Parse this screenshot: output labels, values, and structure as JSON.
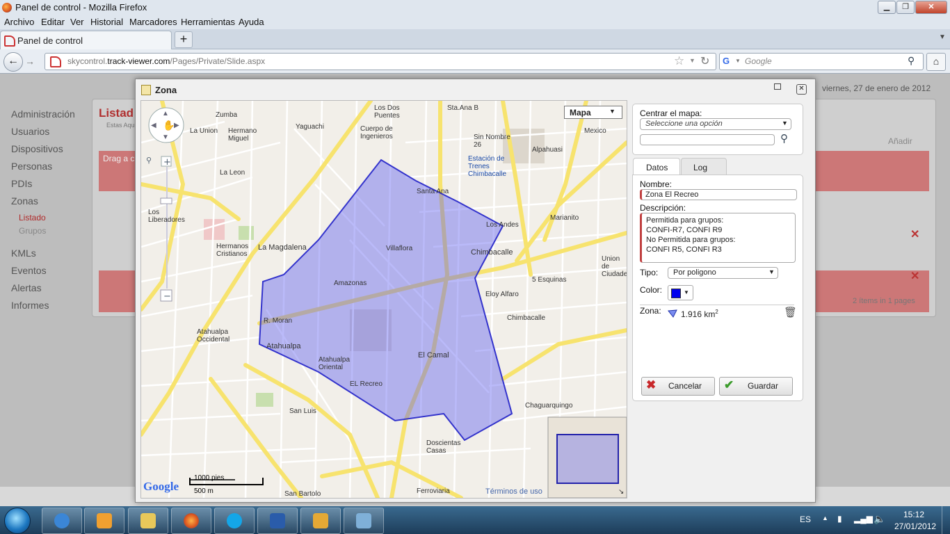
{
  "window": {
    "title": "Panel de control - Mozilla Firefox"
  },
  "menu": [
    "Archivo",
    "Editar",
    "Ver",
    "Historial",
    "Marcadores",
    "Herramientas",
    "Ayuda"
  ],
  "tab": {
    "label": "Panel de control",
    "new_tab": "+"
  },
  "nav": {
    "url_prefix": "skycontrol.",
    "url_domain": "track-viewer.com",
    "url_path": "/Pages/Private/Slide.aspx",
    "search_placeholder": "Google"
  },
  "page": {
    "date": "viernes, 27 de enero de 2012",
    "sidebar": [
      {
        "label": "Administración"
      },
      {
        "label": "Usuarios"
      },
      {
        "label": "Dispositivos"
      },
      {
        "label": "Personas"
      },
      {
        "label": "PDIs"
      },
      {
        "label": "Zonas"
      },
      {
        "label": "Listado"
      },
      {
        "label": "Grupos"
      },
      {
        "label": "KMLs"
      },
      {
        "label": "Eventos"
      },
      {
        "label": "Alertas"
      },
      {
        "label": "Informes"
      }
    ],
    "list_title": "Listad",
    "breadcrumb": "Estas Aqu",
    "drag_hint": "Drag a c",
    "add_label": "Añadir",
    "pager": "2 ítems in 1 pages"
  },
  "dialog": {
    "title": "Zona",
    "map_type": "Mapa",
    "scale_ft": "1000 pies",
    "scale_m": "500 m",
    "terms": "Términos de uso",
    "map_labels": [
      "Zumba",
      "Los Dos Puentes",
      "Sta.Ana B",
      "La Union",
      "Hermano Miguel",
      "Yaguachi",
      "Cuerpo de Ingenieros",
      "Sin Nombre 26",
      "Estación de Trenes Chimbacalle",
      "Alpahuasi",
      "Mexico",
      "La Leon",
      "Santa Ana",
      "Los Liberadores",
      "La Magdalena",
      "Villaflora",
      "Chimbacalle",
      "Los Andes",
      "Marianito",
      "Hermanos Cristianos",
      "Amazonas",
      "5 Esquinas",
      "Eloy Alfaro",
      "Union de Ciudadela",
      "R. Moran",
      "Chimbacalle",
      "Atahualpa Occidental",
      "Atahualpa",
      "Atahualpa Oriental",
      "El Camal",
      "EL Recreo",
      "Chaguarquingo",
      "San Luis",
      "Doscientas Casas",
      "San Bartolo",
      "Ferroviaria"
    ],
    "centrar_label": "Centrar el mapa:",
    "centrar_select": "Seleccione una opción",
    "tabs": [
      "Datos",
      "Log"
    ],
    "nombre_label": "Nombre:",
    "nombre_value": "Zona El Recreo",
    "descripcion_label": "Descripción:",
    "descripcion_lines": [
      "Permitida para grupos:",
      "CONFI-R7, CONFI R9",
      "No Permitida para grupos:",
      "CONFI R5, CONFI R3"
    ],
    "tipo_label": "Tipo:",
    "tipo_value": "Por poligono",
    "color_label": "Color:",
    "color_value": "#0000ee",
    "zona_label": "Zona:",
    "zona_area": "1.916 km",
    "zona_area_sup": "2",
    "cancel_label": "Cancelar",
    "save_label": "Guardar"
  },
  "taskbar": {
    "lang": "ES",
    "time": "15:12",
    "date": "27/01/2012"
  }
}
